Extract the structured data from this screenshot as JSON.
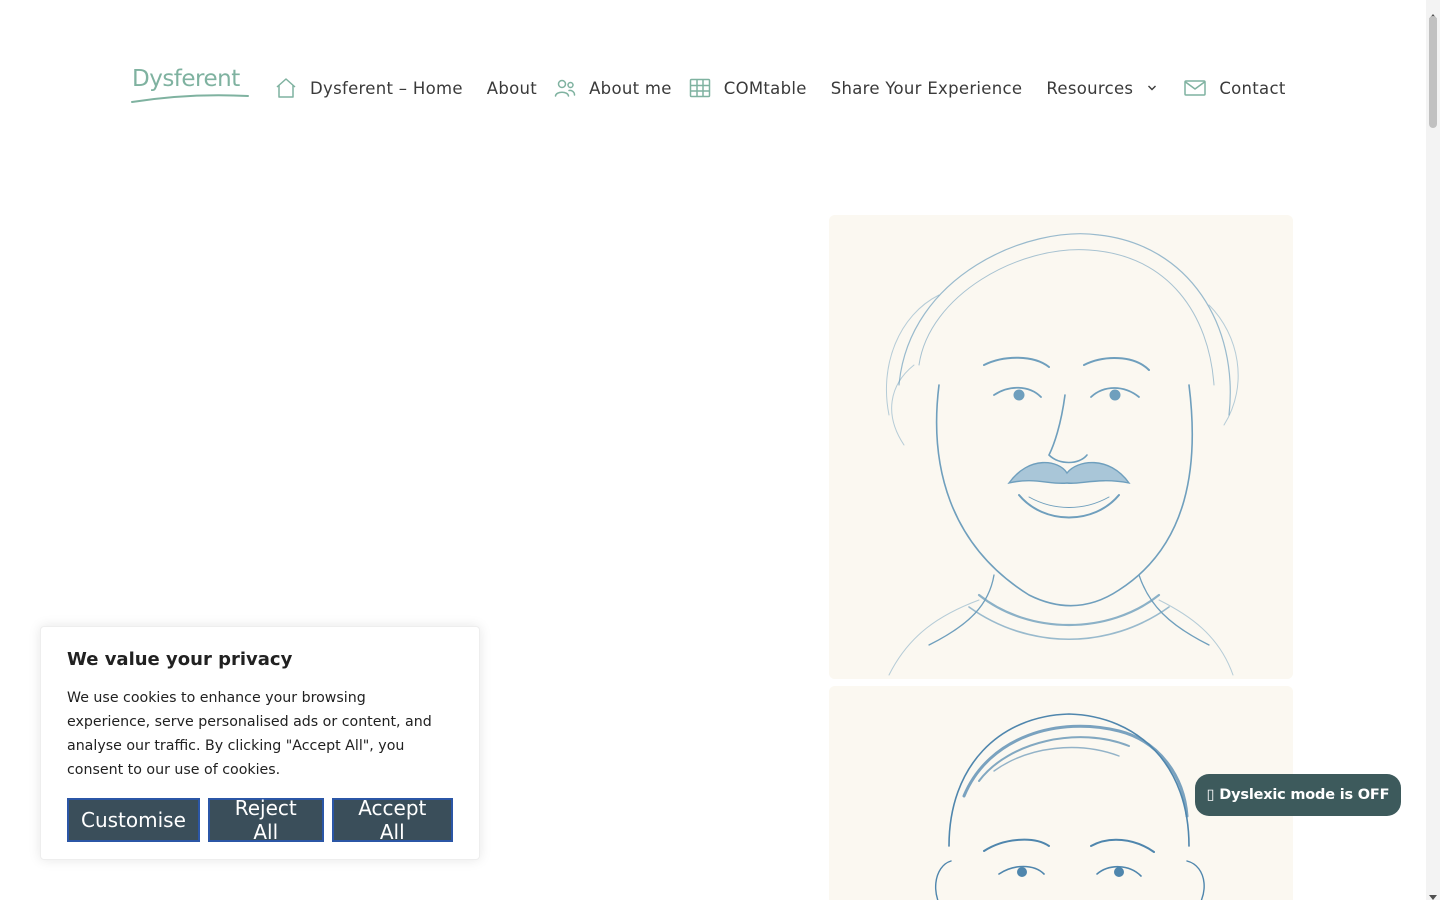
{
  "site": {
    "logo_text": "Dysferent",
    "brand_color": "#7fb2a0"
  },
  "nav": {
    "items": [
      {
        "label": "Dysferent – Home",
        "icon": "home-icon"
      },
      {
        "label": "About",
        "icon": ""
      },
      {
        "label": "About me",
        "icon": "users-icon"
      },
      {
        "label": "COMtable",
        "icon": "table-icon"
      },
      {
        "label": "Share Your Experience",
        "icon": ""
      },
      {
        "label": "Resources",
        "icon": "chevron-down-icon"
      },
      {
        "label": "Contact",
        "icon": "mail-icon"
      }
    ]
  },
  "cookie_banner": {
    "title": "We value your privacy",
    "text": "We use cookies to enhance your browsing experience, serve personalised ads or content, and analyse our traffic. By clicking \"Accept All\", you consent to our use of cookies.",
    "customise_label": "Customise",
    "reject_label": "Reject All",
    "accept_label": "Accept All",
    "button_color": "#3a4e5a"
  },
  "dyslexic_toggle": {
    "label": "▯ Dyslexic mode is OFF",
    "color": "#3d5a5c"
  }
}
